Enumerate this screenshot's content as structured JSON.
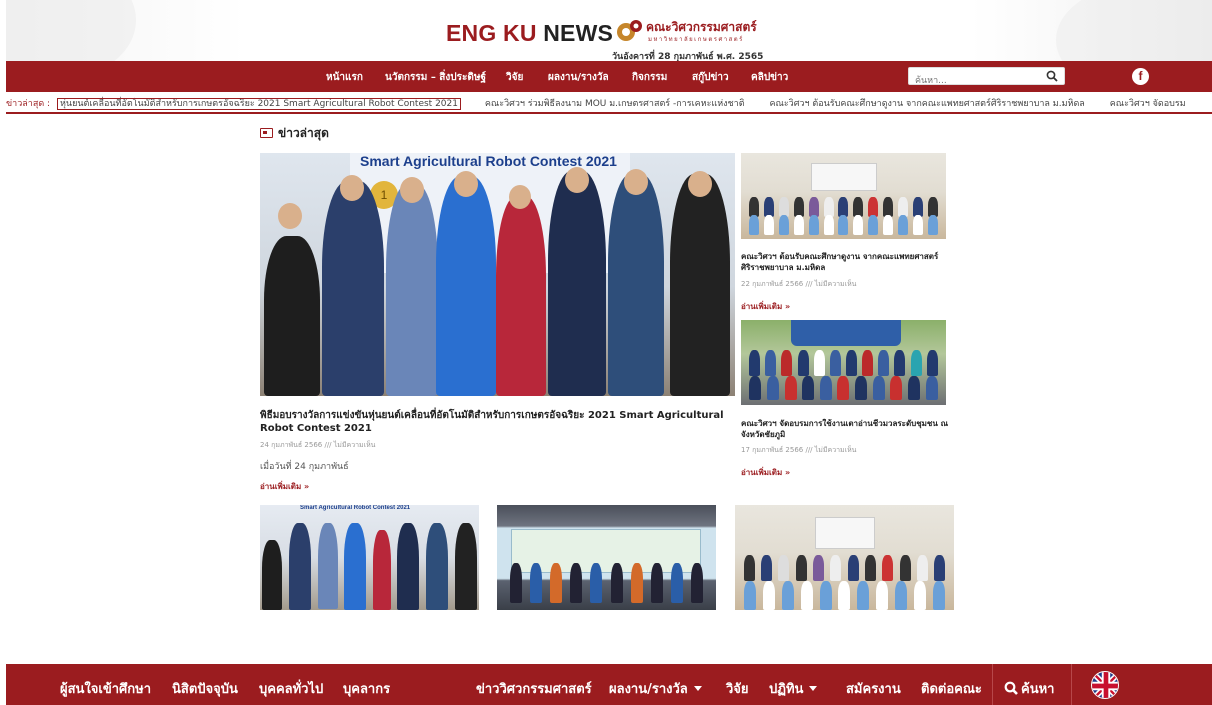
{
  "header": {
    "title_part1": "ENG KU",
    "title_part2": "NEWS",
    "faculty_name": "คณะวิศวกรรมศาสตร์",
    "university_name": "มหาวิทยาลัยเกษตรศาสตร์",
    "date": "วันอังคารที่ 28 กุมภาพันธ์ พ.ศ. 2565",
    "accent_color": "#9b1c1f"
  },
  "top_nav": {
    "items": [
      {
        "label": "หน้าแรก"
      },
      {
        "label": "นวัตกรรม – สิ่งประดิษฐ์"
      },
      {
        "label": "วิจัย"
      },
      {
        "label": "ผลงาน/รางวัล"
      },
      {
        "label": "กิจกรรม"
      },
      {
        "label": "สกู๊ปข่าว"
      },
      {
        "label": "คลิปข่าว"
      }
    ],
    "search_placeholder": "ค้นหา...",
    "facebook_icon": "facebook-icon"
  },
  "ticker": {
    "label": "ข่าวล่าสุด :",
    "items": [
      "หุ่นยนต์เคลื่อนที่อัตโนมัติสำหรับการเกษตรอัจฉริยะ 2021 Smart Agricultural Robot Contest 2021",
      "คณะวิศวฯ ร่วมพิธีลงนาม MOU ม.เกษตรศาสตร์ -การเคหะแห่งชาติ",
      "คณะวิศวฯ ต้อนรับคณะศึกษาดูงาน จากคณะแพทยศาสตร์ศิริราชพยาบาล ม.มหิดล",
      "คณะวิศวฯ จัดอบรม"
    ]
  },
  "section": {
    "title": "ข่าวล่าสุด"
  },
  "featured": {
    "photo_banner_text": "Smart Agricultural Robot Contest 2021",
    "photo_medal": "1",
    "title": "พิธีมอบรางวัลการแข่งขันหุ่นยนต์เคลื่อนที่อัตโนมัติสำหรับการเกษตรอัจฉริยะ 2021 Smart Agricultural Robot Contest 2021",
    "meta": "24 กุมภาพันธ์ 2566 /// ไม่มีความเห็น",
    "excerpt": "เมื่อวันที่ 24 กุมภาพันธ์",
    "read_more": "อ่านเพิ่มเติม »"
  },
  "side_cards": [
    {
      "title": "คณะวิศวฯ ต้อนรับคณะศึกษาดูงาน จากคณะแพทยศาสตร์ศิริราชพยาบาล ม.มหิดล",
      "meta": "22 กุมภาพันธ์ 2566 /// ไม่มีความเห็น",
      "read_more": "อ่านเพิ่มเติม »"
    },
    {
      "title": "คณะวิศวฯ จัดอบรมการใช้งานเตาอ่านชีวมวลระดับชุมชน ณ จังหวัดชัยภูมิ",
      "meta": "17 กุมภาพันธ์ 2566 /// ไม่มีความเห็น",
      "read_more": "อ่านเพิ่มเติม »"
    }
  ],
  "thumbnails": {
    "thumb1_banner_text": "Smart Agricultural Robot Contest 2021"
  },
  "footer_nav": {
    "items": [
      {
        "label": "ผู้สนใจเข้าศึกษา"
      },
      {
        "label": "นิสิตปัจจุบัน"
      },
      {
        "label": "บุคคลทั่วไป"
      },
      {
        "label": "บุคลากร"
      },
      {
        "label": "ข่าววิศวกรรมศาสตร์"
      },
      {
        "label": "ผลงาน/รางวัล"
      },
      {
        "label": "วิจัย"
      },
      {
        "label": "ปฏิทิน"
      },
      {
        "label": "สมัครงาน"
      },
      {
        "label": "ติดต่อคณะ"
      }
    ],
    "search_label": "ค้นหา",
    "language_icon": "uk-flag-icon"
  }
}
